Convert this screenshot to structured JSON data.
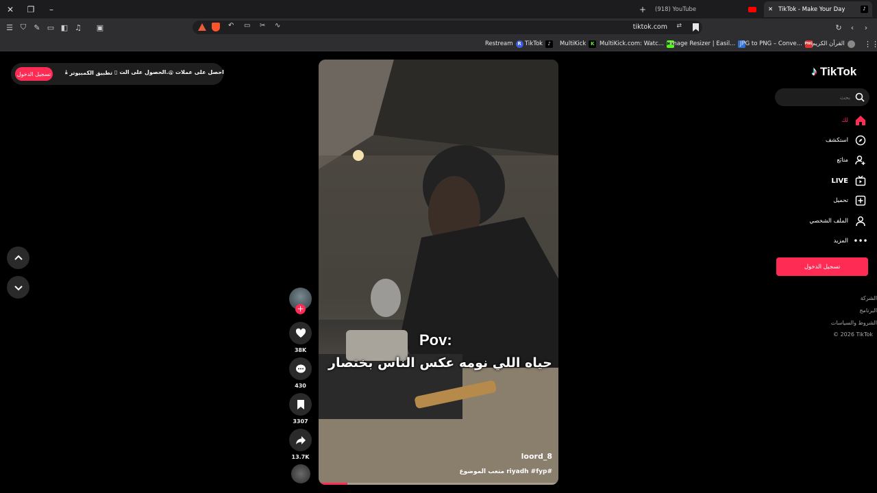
{
  "browser": {
    "tabs": [
      {
        "label": "(918) YouTube"
      },
      {
        "label": "TikTok - Make Your Day"
      }
    ],
    "url": "tiktok.com",
    "bookmarks": [
      "Restream",
      "TikTok",
      "MultiKick",
      "MultiKick.com: Watc...",
      "Image Resizer | Easil...",
      "JPG to PNG – Conve...",
      "القرآن الكريم"
    ]
  },
  "top_pill": {
    "login": "تسجيل الدخول",
    "desktop_app": "تطبيق الكمبيوتر",
    "get_app": "الحصول على الت...",
    "coins": "احصل على عملات"
  },
  "video": {
    "overlay_line1": "Pov:",
    "overlay_line2": "حياه اللي نومه عكس الناس بختصار",
    "author": "loord_8",
    "caption": "#riyadh #fyp متعب الموضوع",
    "progress": 0.12
  },
  "actions": {
    "likes": "38K",
    "comments": "430",
    "saves": "3307",
    "shares": "13.7K"
  },
  "sidebar": {
    "logo": "TikTok",
    "search_placeholder": "بحث",
    "items": [
      {
        "label": "لك"
      },
      {
        "label": "استكشف"
      },
      {
        "label": "متابَع"
      },
      {
        "label": "LIVE"
      },
      {
        "label": "تحميل"
      },
      {
        "label": "الملف الشخصي"
      },
      {
        "label": "المزيد"
      }
    ],
    "login": "تسجيل الدخول",
    "footer": [
      "الشركة",
      "البرنامج",
      "الشروط والسياسات",
      "© 2026 TikTok"
    ]
  },
  "colors": {
    "accent": "#fe2c55"
  }
}
